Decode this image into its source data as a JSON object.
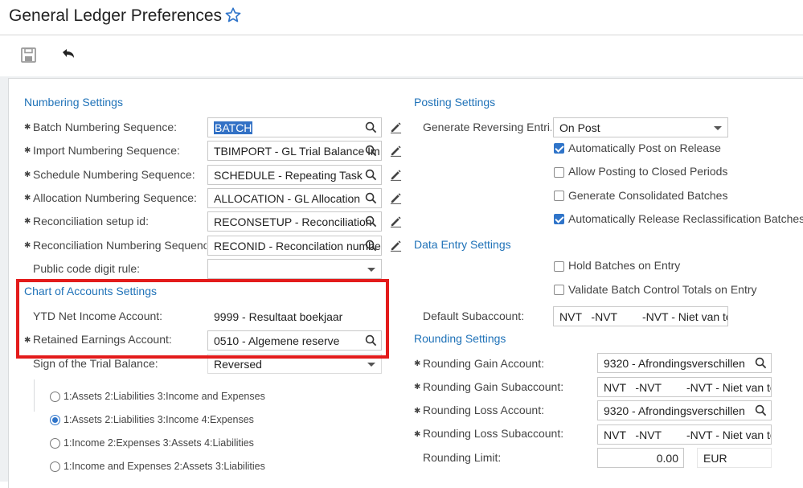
{
  "page": {
    "title": "General Ledger Preferences"
  },
  "toolbar": {
    "save": "save",
    "undo": "undo"
  },
  "numbering": {
    "section_title": "Numbering Settings",
    "batch": {
      "label": "Batch Numbering Sequence:",
      "value": "BATCH"
    },
    "import": {
      "label": "Import Numbering Sequence:",
      "value": "TBIMPORT - GL Trial Balance Im"
    },
    "schedule": {
      "label": "Schedule Numbering Sequence:",
      "value": "SCHEDULE - Repeating Task"
    },
    "allocation": {
      "label": "Allocation Numbering Sequence:",
      "value": "ALLOCATION - GL Allocation"
    },
    "recon_setup": {
      "label": "Reconciliation setup id:",
      "value": "RECONSETUP - Reconciliation"
    },
    "recon_numbering": {
      "label": "Reconciliation Numbering Sequence:",
      "value": "RECONID - Reconcilation numbe"
    },
    "public_code": {
      "label": "Public code digit rule:",
      "value": ""
    }
  },
  "chart_of_accounts": {
    "section_title": "Chart of Accounts Settings",
    "ytd": {
      "label": "YTD Net Income Account:",
      "value": "9999 - Resultaat boekjaar"
    },
    "retained": {
      "label": "Retained Earnings Account:",
      "value": "0510 - Algemene reserve"
    },
    "sign": {
      "label": "Sign of the Trial Balance:",
      "value": "Reversed"
    },
    "options": [
      {
        "label": "1:Assets 2:Liabilities 3:Income and Expenses",
        "selected": false
      },
      {
        "label": "1:Assets 2:Liabilities 3:Income 4:Expenses",
        "selected": true
      },
      {
        "label": "1:Income 2:Expenses 3:Assets 4:Liabilities",
        "selected": false
      },
      {
        "label": "1:Income and Expenses 2:Assets 3:Liabilities",
        "selected": false
      }
    ]
  },
  "posting": {
    "section_title": "Posting Settings",
    "reversing": {
      "label": "Generate Reversing Entri...",
      "value": "On Post"
    },
    "checks": [
      {
        "label": "Automatically Post on Release",
        "checked": true
      },
      {
        "label": "Allow Posting to Closed Periods",
        "checked": false
      },
      {
        "label": "Generate Consolidated Batches",
        "checked": false
      },
      {
        "label": "Automatically Release Reclassification Batches",
        "checked": true
      }
    ]
  },
  "data_entry": {
    "section_title": "Data Entry Settings",
    "checks": [
      {
        "label": "Hold Batches on Entry",
        "checked": false
      },
      {
        "label": "Validate Batch Control Totals on Entry",
        "checked": false
      }
    ],
    "default_sub": {
      "label": "Default Subaccount:",
      "value": "NVT   -NVT        -NVT - Niet van toe"
    }
  },
  "rounding": {
    "section_title": "Rounding Settings",
    "gain_account": {
      "label": "Rounding Gain Account:",
      "value": "9320 - Afrondingsverschillen"
    },
    "gain_sub": {
      "label": "Rounding Gain Subaccount:",
      "value": "NVT   -NVT        -NVT - Niet van toe"
    },
    "loss_account": {
      "label": "Rounding Loss Account:",
      "value": "9320 - Afrondingsverschillen"
    },
    "loss_sub": {
      "label": "Rounding Loss Subaccount:",
      "value": "NVT   -NVT        -NVT - Niet van toe"
    },
    "limit": {
      "label": "Rounding Limit:",
      "value": "0.00",
      "currency": "EUR"
    }
  },
  "colors": {
    "accent": "#1f72b8",
    "highlight": "#e31b1b",
    "check": "#2f74c9"
  }
}
